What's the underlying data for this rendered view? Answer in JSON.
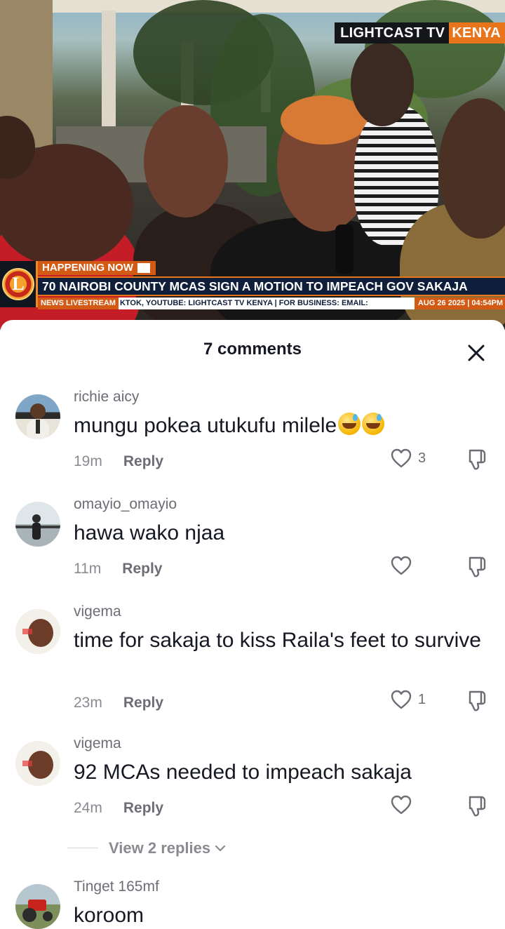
{
  "video": {
    "watermark": {
      "part1": "LIGHTCAST TV",
      "part2": "KENYA"
    },
    "ticker": {
      "logo_letter": "L",
      "happening_now": "HAPPENING NOW",
      "headline": "70 NAIROBI COUNTY MCAS SIGN A MOTION TO IMPEACH GOV SAKAJA",
      "tag": "NEWS LIVESTREAM",
      "crawl": "KTOK, YOUTUBE: LIGHTCAST TV KENYA | FOR BUSINESS: EMAIL:",
      "datetime": "AUG 26 2025 | 04:54PM"
    }
  },
  "comments_sheet": {
    "title": "7 comments",
    "close_icon": "close-icon",
    "reply_label": "Reply",
    "view_replies": "View 2 replies",
    "comments": [
      {
        "username": "richie aicy",
        "text": "mungu pokea utukufu milele",
        "emoji_count": 2,
        "time": "19m",
        "likes": "3"
      },
      {
        "username": "omayio_omayio",
        "text": "hawa wako njaa",
        "time": "11m",
        "likes": ""
      },
      {
        "username": "vigema",
        "text": "time for sakaja to kiss Raila's feet to survive",
        "time": "23m",
        "likes": "1"
      },
      {
        "username": "vigema",
        "text": "92 MCAs needed to impeach sakaja",
        "time": "24m",
        "likes": ""
      },
      {
        "username": "Tinget 165mf",
        "text": "koroom"
      }
    ]
  },
  "colors": {
    "accent_orange": "#e8741b",
    "navy": "#0f1e3a",
    "text": "#161823",
    "muted": "#8a8b91"
  }
}
